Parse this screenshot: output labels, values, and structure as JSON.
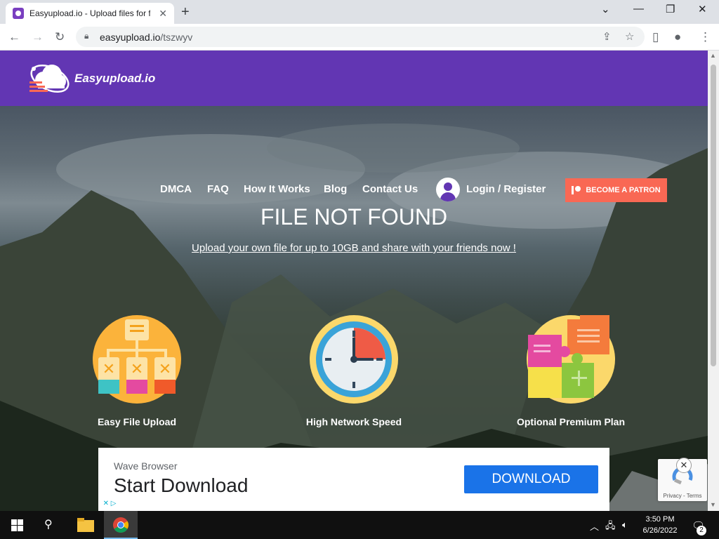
{
  "browser": {
    "tab_title": "Easyupload.io - Upload files for free",
    "tab_close": "✕",
    "new_tab": "+",
    "url_domain": "easyupload.io",
    "url_path": "/tszwyv",
    "window_controls": {
      "minimize": "—",
      "maximize": "❐",
      "close": "✕",
      "tab_search": "⌄"
    }
  },
  "site": {
    "logo_text": "Easyupload.io",
    "nav": [
      "DMCA",
      "FAQ",
      "How It Works",
      "Blog",
      "Contact Us"
    ],
    "login_label": "Login / Register",
    "patron_label": "BECOME A PATRON",
    "heading": "FILE NOT FOUND",
    "subheading": "Upload your own file for up to 10GB and share with your friends now !",
    "features": [
      {
        "label": "Easy File Upload",
        "icon": "file-tree-icon"
      },
      {
        "label": "High Network Speed",
        "icon": "clock-icon"
      },
      {
        "label": "Optional Premium Plan",
        "icon": "puzzle-icon"
      }
    ]
  },
  "ad": {
    "brand": "Wave Browser",
    "headline": "Start Download",
    "button": "DOWNLOAD",
    "adchoices": "✕ ▷"
  },
  "recaptcha": {
    "terms": "Privacy - Terms",
    "close": "✕"
  },
  "taskbar": {
    "time": "3:50 PM",
    "date": "6/26/2022",
    "notification_count": "2"
  },
  "colors": {
    "header": "#6236b3",
    "patron": "#f96854",
    "download": "#1a73e8"
  }
}
